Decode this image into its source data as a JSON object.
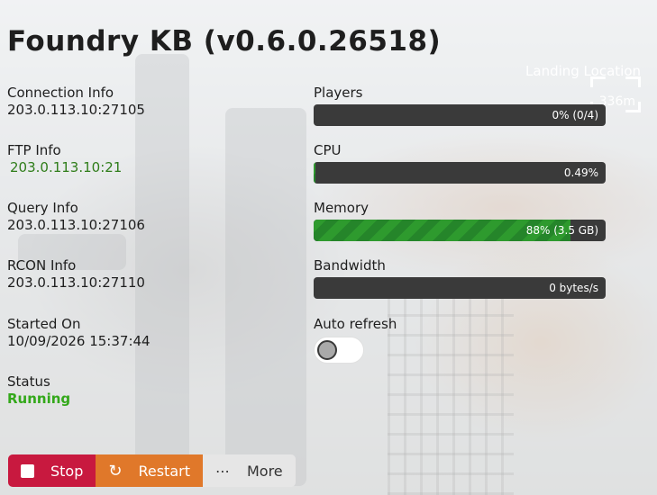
{
  "header": {
    "title": "Foundry KB (v0.6.0.26518)"
  },
  "map_overlay": {
    "label": "Landing Location",
    "distance": "336m"
  },
  "info": {
    "connection": {
      "label": "Connection Info",
      "value": "203.0.113.10:27105"
    },
    "ftp": {
      "label": "FTP Info",
      "value": "203.0.113.10:21"
    },
    "query": {
      "label": "Query Info",
      "value": "203.0.113.10:27106"
    },
    "rcon": {
      "label": "RCON Info",
      "value": "203.0.113.10:27110"
    },
    "started": {
      "label": "Started On",
      "value": "10/09/2026 15:37:44"
    },
    "status": {
      "label": "Status",
      "value": "Running"
    }
  },
  "stats": {
    "players": {
      "label": "Players",
      "text": "0% (0/4)",
      "percent": 0
    },
    "cpu": {
      "label": "CPU",
      "text": "0.49%",
      "percent": 0.49
    },
    "memory": {
      "label": "Memory",
      "text": "88% (3.5 GB)",
      "percent": 88
    },
    "bandwidth": {
      "label": "Bandwidth",
      "text": "0 bytes/s",
      "percent": 0
    }
  },
  "auto_refresh": {
    "label": "Auto refresh",
    "enabled": false
  },
  "actions": {
    "stop": "Stop",
    "restart": "Restart",
    "more": "More"
  },
  "colors": {
    "stop": "#c8193f",
    "restart": "#e0782a",
    "running": "#33a81a",
    "ftp_value": "#2f7d1a",
    "bar_bg": "#3a3a3a",
    "bar_fill": "#2e9a2e"
  }
}
